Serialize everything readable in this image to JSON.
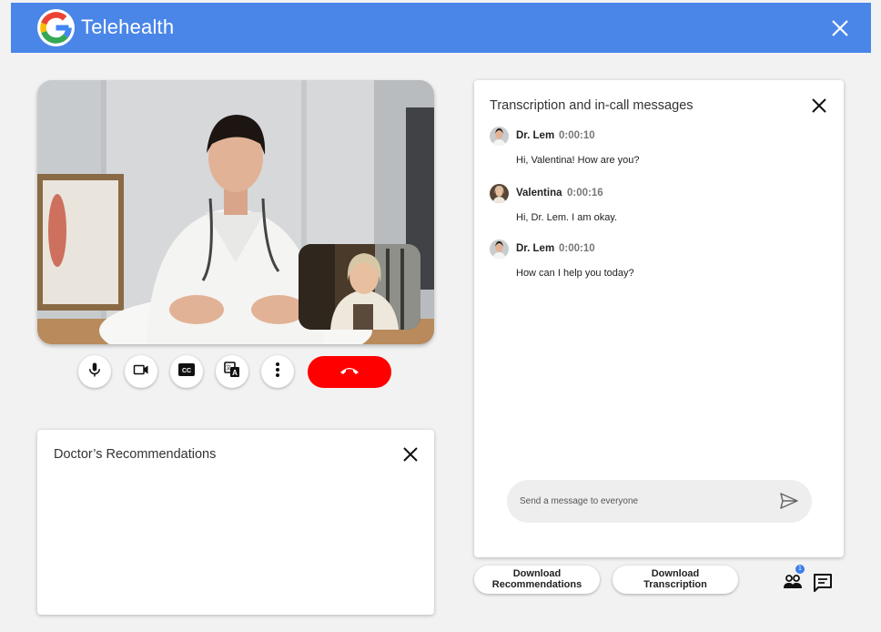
{
  "app": {
    "title": "Telehealth",
    "logo_letter": "G"
  },
  "colors": {
    "topbar": "#4a86e8",
    "end_call": "#ff0000",
    "badge": "#3b7ded"
  },
  "controls": [
    "microphone-icon",
    "video-camera-icon",
    "closed-captions-icon",
    "translate-icon",
    "more-vert-icon",
    "call-end-icon"
  ],
  "recommendations": {
    "title": "Doctor’s Recommendations"
  },
  "chat": {
    "title": "Transcription and in-call messages",
    "messages": [
      {
        "sender": "Dr. Lem",
        "time": "0:00:10",
        "text": "Hi, Valentina! How are you?"
      },
      {
        "sender": "Valentina",
        "time": "0:00:16",
        "text": "Hi, Dr. Lem. I am okay."
      },
      {
        "sender": "Dr. Lem",
        "time": "0:00:10",
        "text": "How can I help you today?"
      }
    ],
    "input_placeholder": "Send a message to everyone"
  },
  "actions": {
    "download_recommendations": [
      "Download",
      "Recommendations"
    ],
    "download_transcription": [
      "Download",
      "Transcription"
    ],
    "participants_count": "1"
  }
}
